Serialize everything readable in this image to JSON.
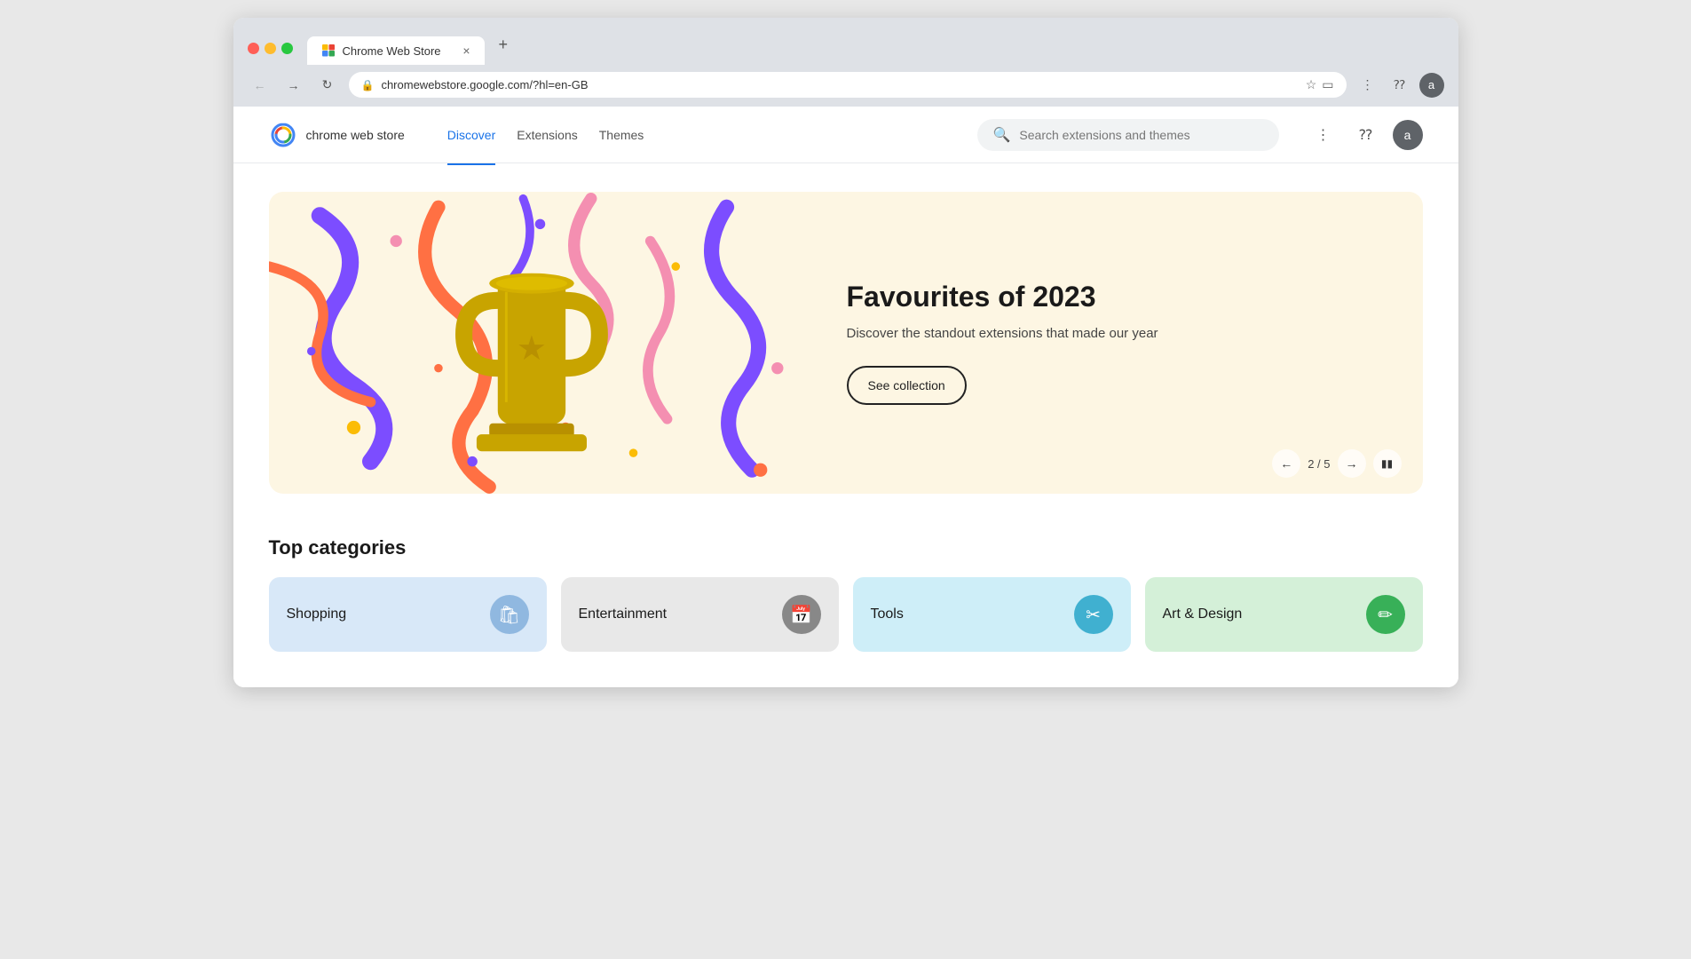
{
  "browser": {
    "tab_title": "Chrome Web Store",
    "url": "chromewebstore.google.com/?hl=en-GB",
    "tab_close": "×",
    "tab_new": "+"
  },
  "store_nav": {
    "store_name": "chrome web store",
    "nav_items": [
      {
        "label": "Discover",
        "active": true
      },
      {
        "label": "Extensions",
        "active": false
      },
      {
        "label": "Themes",
        "active": false
      }
    ],
    "search_placeholder": "Search extensions and themes",
    "avatar_letter": "a"
  },
  "hero": {
    "title": "Favourites of 2023",
    "subtitle": "Discover the standout extensions that made our year",
    "cta_label": "See collection",
    "carousel_indicator": "2 / 5"
  },
  "categories": {
    "section_title": "Top categories",
    "items": [
      {
        "label": "Shopping",
        "theme": "shopping",
        "icon": "🛍",
        "icon_theme": "shopping"
      },
      {
        "label": "Entertainment",
        "theme": "entertainment",
        "icon": "📅",
        "icon_theme": "entertainment"
      },
      {
        "label": "Tools",
        "theme": "tools",
        "icon": "✂",
        "icon_theme": "tools"
      },
      {
        "label": "Art & Design",
        "theme": "art",
        "icon": "✏",
        "icon_theme": "art"
      }
    ]
  }
}
